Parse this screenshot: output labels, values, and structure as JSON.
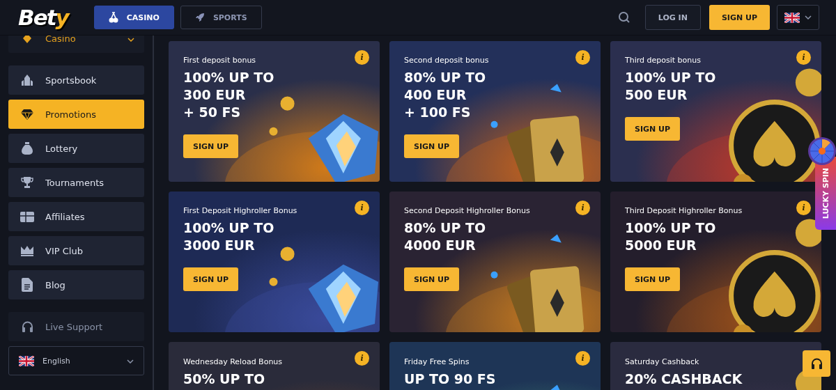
{
  "header": {
    "logo": {
      "main": "Bet",
      "accent": "y"
    },
    "tabs": [
      {
        "label": "CASINO",
        "selected": true
      },
      {
        "label": "SPORTS",
        "selected": false
      }
    ],
    "login": "LOG IN",
    "signup": "SIGN UP"
  },
  "sidebar": {
    "items": [
      {
        "label": "Casino",
        "kind": "section",
        "selected": false
      },
      {
        "label": "Sportsbook",
        "kind": "item",
        "selected": false
      },
      {
        "label": "Promotions",
        "kind": "item",
        "selected": true
      },
      {
        "label": "Lottery",
        "kind": "item",
        "selected": false
      },
      {
        "label": "Tournaments",
        "kind": "item",
        "selected": false
      },
      {
        "label": "Affiliates",
        "kind": "item",
        "selected": false
      },
      {
        "label": "VIP Club",
        "kind": "item",
        "selected": false
      },
      {
        "label": "Blog",
        "kind": "item",
        "selected": false
      }
    ],
    "support": "Live Support",
    "language": "English"
  },
  "promotions": [
    {
      "title": "First deposit bonus",
      "headline": "100% UP TO\n300 EUR\n+ 50 FS",
      "info": "i",
      "button": "SIGN UP"
    },
    {
      "title": "Second deposit bonus",
      "headline": "80% UP TO\n400 EUR\n+ 100 FS",
      "info": "i",
      "button": "SIGN UP"
    },
    {
      "title": "Third deposit bonus",
      "headline": "100% UP TO\n500 EUR",
      "info": "i",
      "button": "SIGN UP"
    },
    {
      "title": "First Deposit Highroller Bonus",
      "headline": "100% UP TO\n3000 EUR",
      "info": "i",
      "button": "SIGN UP"
    },
    {
      "title": "Second Deposit Highroller Bonus",
      "headline": "80% UP TO\n4000 EUR",
      "info": "i",
      "button": "SIGN UP"
    },
    {
      "title": "Third Deposit Highroller Bonus",
      "headline": "100% UP TO\n5000 EUR",
      "info": "i",
      "button": "SIGN UP"
    },
    {
      "title": "Wednesday Reload Bonus",
      "headline": "50% UP TO",
      "info": "i"
    },
    {
      "title": "Friday Free Spins",
      "headline": "UP TO 90 FS",
      "info": "i"
    },
    {
      "title": "Saturday Cashback",
      "headline": "20% CASHBACK"
    }
  ],
  "lucky_spin": "LUCKY SPIN"
}
